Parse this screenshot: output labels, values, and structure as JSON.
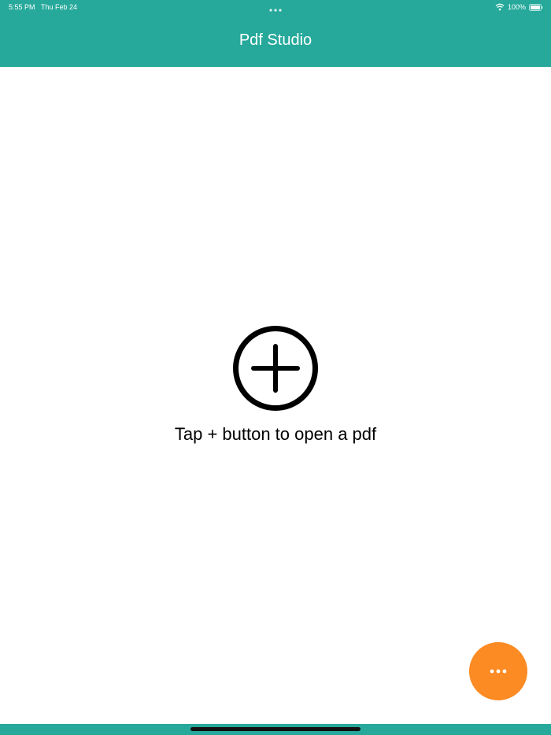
{
  "colors": {
    "header": "#26a99b",
    "fab": "#fd8b23",
    "background": "#ffffff",
    "text": "#000000"
  },
  "status_bar": {
    "time": "5:55 PM",
    "date": "Thu Feb 24",
    "battery": "100%",
    "icons": [
      "multitasking-dots-icon",
      "wifi-icon",
      "battery-icon"
    ]
  },
  "header": {
    "title": "Pdf Studio"
  },
  "main": {
    "add_icon": "plus-circle-icon",
    "empty_message": "Tap + button to open a pdf"
  },
  "fab": {
    "icon": "more-horizontal-icon"
  }
}
